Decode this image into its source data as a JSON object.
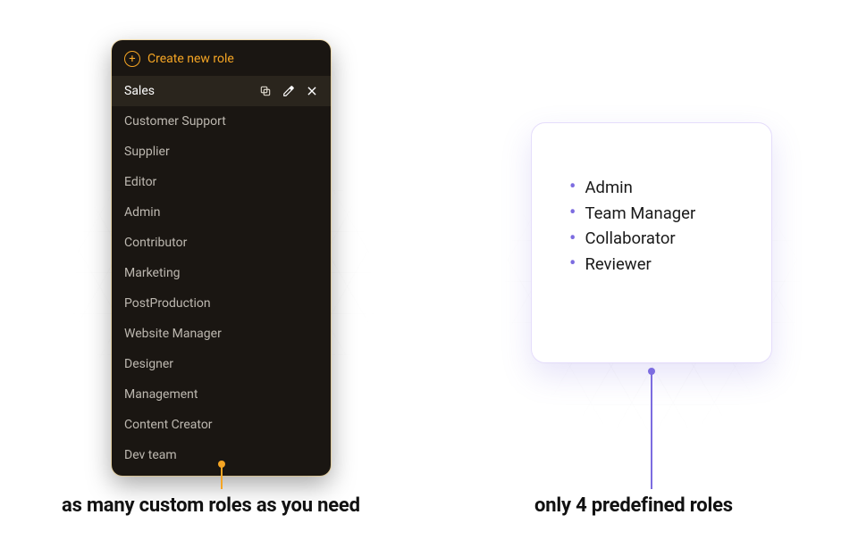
{
  "left": {
    "create_label": "Create new role",
    "roles": [
      "Sales",
      "Customer Support",
      "Supplier",
      "Editor",
      "Admin",
      "Contributor",
      "Marketing",
      "PostProduction",
      "Website Manager",
      "Designer",
      "Management",
      "Content Creator",
      "Dev team"
    ],
    "selected_index": 0,
    "caption": "as many custom roles as you need"
  },
  "right": {
    "roles": [
      "Admin",
      "Team Manager",
      "Collaborator",
      "Reviewer"
    ],
    "caption": "only 4 predefined roles"
  },
  "colors": {
    "accent_left": "#f5a524",
    "accent_right": "#7c6ce0"
  }
}
